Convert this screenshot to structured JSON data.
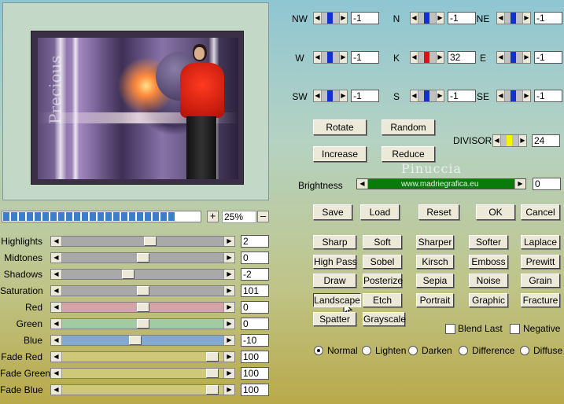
{
  "controls": {
    "percent": "25%",
    "plus": "+",
    "minus": "–",
    "progress_segments": 22
  },
  "sliders": [
    {
      "label": "Highlights",
      "value": "2",
      "track": "#a9a9a9",
      "pos": 0.55
    },
    {
      "label": "Midtones",
      "value": "0",
      "track": "#a9a9a9",
      "pos": 0.5
    },
    {
      "label": "Shadows",
      "value": "-2",
      "track": "#a9a9a9",
      "pos": 0.4
    },
    {
      "label": "Saturation",
      "value": "101",
      "track": "#a9a9a9",
      "pos": 0.5
    },
    {
      "label": "Red",
      "value": "0",
      "track": "#d4a3a6",
      "pos": 0.5
    },
    {
      "label": "Green",
      "value": "0",
      "track": "#a3cba3",
      "pos": 0.5
    },
    {
      "label": "Blue",
      "value": "-10",
      "track": "#82a9cf",
      "pos": 0.45
    },
    {
      "label": "Fade Red",
      "value": "100",
      "track": "#cfc87a",
      "pos": 0.97
    },
    {
      "label": "Fade Green",
      "value": "100",
      "track": "#cfc87a",
      "pos": 0.97
    },
    {
      "label": "Fade Blue",
      "value": "100",
      "track": "#cfc87a",
      "pos": 0.97
    }
  ],
  "matrix": [
    {
      "label": "NW",
      "value": "-1",
      "knob": "#1030d0"
    },
    {
      "label": "N",
      "value": "-1",
      "knob": "#1030d0"
    },
    {
      "label": "NE",
      "value": "-1",
      "knob": "#1030d0"
    },
    {
      "label": "W",
      "value": "-1",
      "knob": "#1030d0"
    },
    {
      "label": "K",
      "value": "32",
      "knob": "#e01010"
    },
    {
      "label": "E",
      "value": "-1",
      "knob": "#1030d0"
    },
    {
      "label": "SW",
      "value": "-1",
      "knob": "#1030d0"
    },
    {
      "label": "S",
      "value": "-1",
      "knob": "#1030d0"
    },
    {
      "label": "SE",
      "value": "-1",
      "knob": "#1030d0"
    }
  ],
  "actions": {
    "rotate": "Rotate",
    "random": "Random",
    "increase": "Increase",
    "reduce": "Reduce",
    "divisor_label": "DIVISOR",
    "divisor_value": "24",
    "divisor_knob": "#f5f500",
    "brightness_label": "Brightness",
    "brightness_value": "0",
    "save": "Save",
    "load": "Load",
    "reset": "Reset",
    "ok": "OK",
    "cancel": "Cancel"
  },
  "watermark": {
    "name": "Pinuccia",
    "url": "www.madriegrafica.eu"
  },
  "filters": [
    "Sharp",
    "Soft",
    "Sharper",
    "Softer",
    "Laplace",
    "High Pass",
    "Sobel",
    "Kirsch",
    "Emboss",
    "Prewitt",
    "Draw",
    "Posterize",
    "Sepia",
    "Noise",
    "Grain",
    "Landscape",
    "Etch",
    "Portrait",
    "Graphic",
    "Fracture",
    "Spatter",
    "Grayscale"
  ],
  "options": {
    "blend_last": "Blend Last",
    "negative": "Negative",
    "modes": [
      "Normal",
      "Lighten",
      "Darken",
      "Difference",
      "Diffuse"
    ],
    "selected_mode": "Normal"
  },
  "preview_text": "Precious"
}
